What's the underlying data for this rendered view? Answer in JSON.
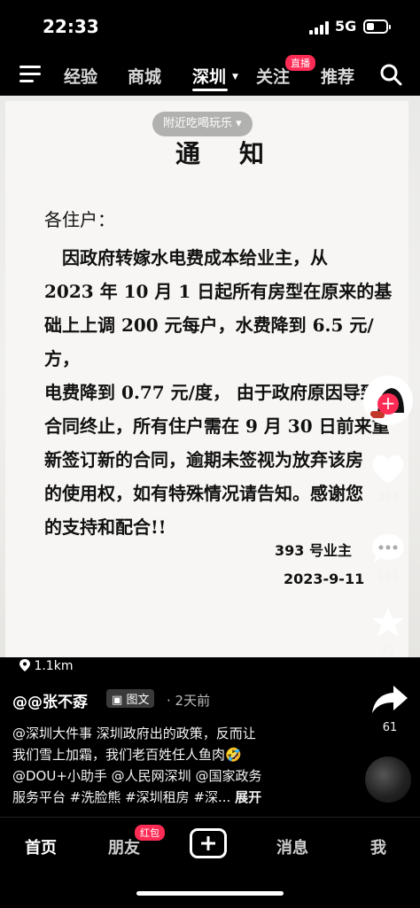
{
  "status": {
    "time": "22:33",
    "network": "5G"
  },
  "topnav": {
    "tabs": [
      {
        "label": "经验"
      },
      {
        "label": "商城"
      },
      {
        "label": "深圳"
      },
      {
        "label": "关注"
      },
      {
        "label": "推荐"
      }
    ],
    "live_badge": "直播"
  },
  "photo": {
    "chip": "附近吃喝玩乐 ▾",
    "notice": {
      "title": "通知",
      "greeting": "各住户：",
      "body_lines": [
        "　因政府转嫁水电费成本给业主，从",
        "2023 年 10 月 1 日起所有房型在原来的基",
        "础上上调 200 元每户，水费降到 6.5 元/方，",
        "电费降到 0.77 元/度， 由于政府原因导致",
        "合同终止，所有住户需在 9 月 30 日前来重",
        "新签订新的合同，逾期未签视为放弃该房",
        "的使用权，如有特殊情况请告知。感谢您",
        "的支持和配合!!"
      ],
      "signature": "393 号业主",
      "date": "2023-9-11"
    }
  },
  "rail": {
    "likes": "334",
    "comments": "131",
    "favorites": "22",
    "shares": "61"
  },
  "meta": {
    "location": "1.1km",
    "author": "@@张不孬",
    "tag": "图文",
    "time": "· 2天前",
    "desc_lines": [
      "@深圳大件事 深圳政府出的政策，反而让",
      "我们雪上加霜，我们老百姓任人鱼肉🤣",
      "@DOU+小助手 @人民网深圳 @国家政务",
      "服务平台 #洗脸熊 #深圳租房 #深..."
    ],
    "expand": "展开"
  },
  "bottomnav": {
    "home": "首页",
    "friends": "朋友",
    "redpack": "红包",
    "messages": "消息",
    "me": "我"
  },
  "colors": {
    "accent": "#fe2c55",
    "background": "#000000"
  }
}
